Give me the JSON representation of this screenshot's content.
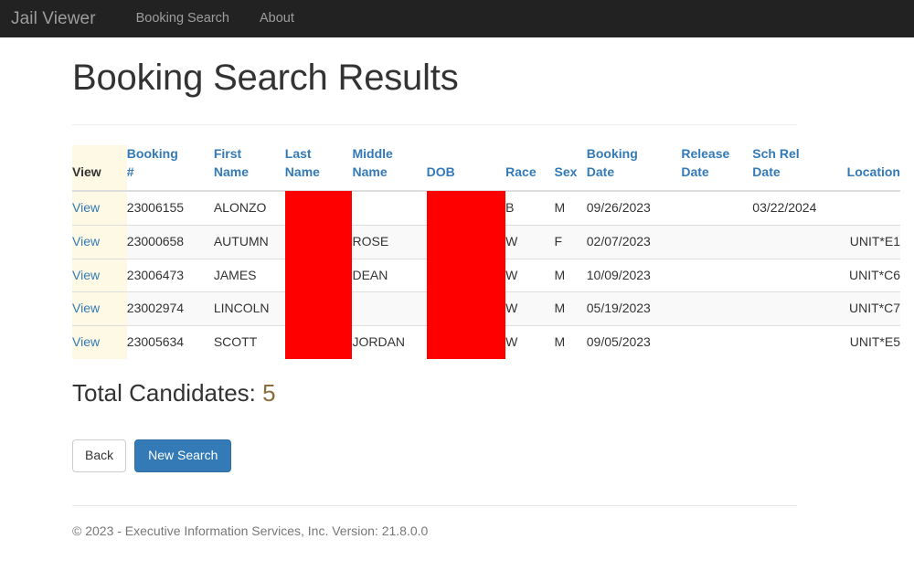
{
  "navbar": {
    "brand": "Jail Viewer",
    "links": [
      {
        "label": "Booking Search"
      },
      {
        "label": "About"
      }
    ]
  },
  "page": {
    "title": "Booking Search Results"
  },
  "table": {
    "headers": {
      "view": "View",
      "booking_number": "Booking\n#",
      "first_name": "First\nName",
      "last_name": "Last\nName",
      "middle_name": "Middle\nName",
      "dob": "DOB",
      "race": "Race",
      "sex": "Sex",
      "booking_date": "Booking\nDate",
      "release_date": "Release\nDate",
      "sch_rel_date": "Sch Rel\nDate",
      "location": "Location"
    },
    "view_link_label": "View",
    "rows": [
      {
        "view": "View",
        "booking_number": "23006155",
        "first_name": "ALONZO",
        "last_name": "",
        "middle_name": "",
        "dob": "",
        "race": "B",
        "sex": "M",
        "booking_date": "09/26/2023",
        "release_date": "",
        "sch_rel_date": "03/22/2024",
        "location": ""
      },
      {
        "view": "View",
        "booking_number": "23000658",
        "first_name": "AUTUMN",
        "last_name": "",
        "middle_name": "ROSE",
        "dob": "",
        "race": "W",
        "sex": "F",
        "booking_date": "02/07/2023",
        "release_date": "",
        "sch_rel_date": "",
        "location": "UNIT*E1"
      },
      {
        "view": "View",
        "booking_number": "23006473",
        "first_name": "JAMES",
        "last_name": "",
        "middle_name": "DEAN",
        "dob": "",
        "race": "W",
        "sex": "M",
        "booking_date": "10/09/2023",
        "release_date": "",
        "sch_rel_date": "",
        "location": "UNIT*C6"
      },
      {
        "view": "View",
        "booking_number": "23002974",
        "first_name": "LINCOLN",
        "last_name": "",
        "middle_name": "",
        "dob": "",
        "race": "W",
        "sex": "M",
        "booking_date": "05/19/2023",
        "release_date": "",
        "sch_rel_date": "",
        "location": "UNIT*C7"
      },
      {
        "view": "View",
        "booking_number": "23005634",
        "first_name": "SCOTT",
        "last_name": "",
        "middle_name": "JORDAN",
        "dob": "",
        "race": "W",
        "sex": "M",
        "booking_date": "09/05/2023",
        "release_date": "",
        "sch_rel_date": "",
        "location": "UNIT*E5"
      }
    ],
    "redactions": [
      {
        "name": "last-name-redaction",
        "color": "#ff0000"
      },
      {
        "name": "dob-redaction",
        "color": "#ff0000"
      }
    ]
  },
  "totals": {
    "label": "Total Candidates:",
    "count": "5",
    "count_color": "#8a6d3b"
  },
  "buttons": {
    "back": "Back",
    "new_search": "New Search",
    "primary_color": "#337ab7"
  },
  "footer": {
    "text": "© 2023 - Executive Information Services, Inc. Version: 21.8.0.0"
  }
}
